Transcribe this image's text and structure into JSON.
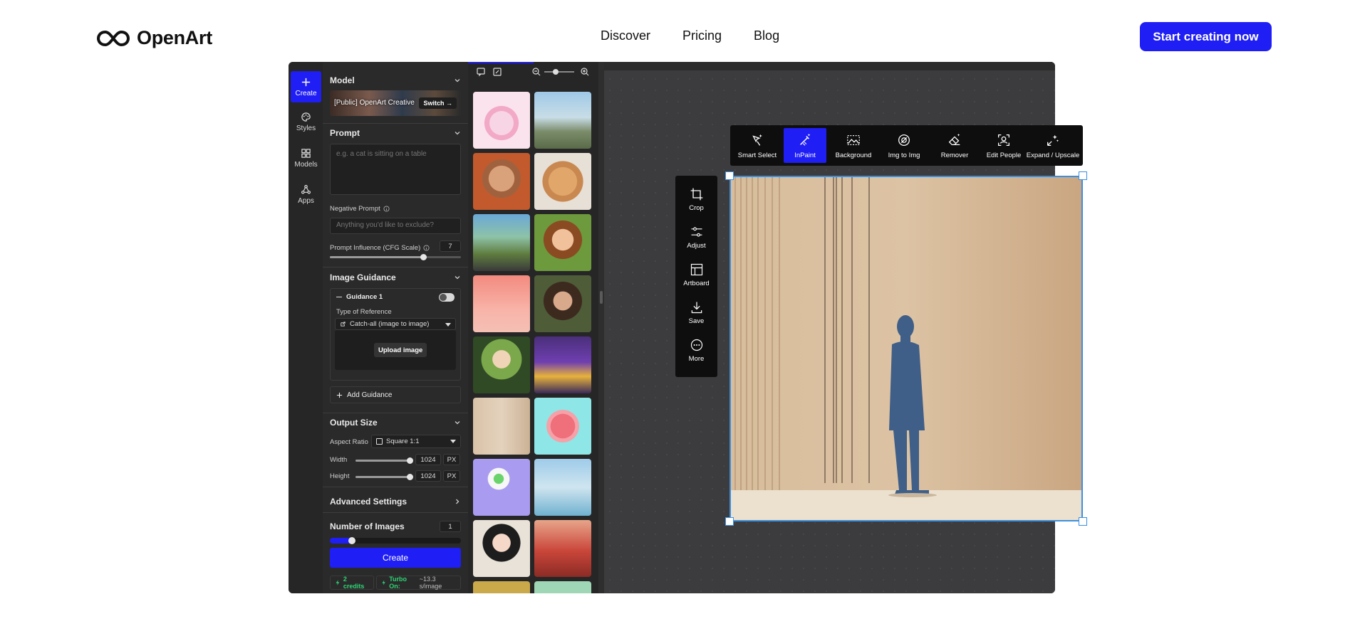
{
  "nav": {
    "brand": "OpenArt",
    "links": [
      "Discover",
      "Pricing",
      "Blog"
    ],
    "cta": "Start creating now"
  },
  "rail": [
    {
      "label": "Create",
      "icon": "plus-icon",
      "active": true
    },
    {
      "label": "Styles",
      "icon": "palette-icon",
      "active": false
    },
    {
      "label": "Models",
      "icon": "grid-icon",
      "active": false
    },
    {
      "label": "Apps",
      "icon": "apps-icon",
      "active": false
    }
  ],
  "panel": {
    "model": {
      "title": "Model",
      "name": "[Public] OpenArt Creative",
      "switch": "Switch →"
    },
    "prompt": {
      "title": "Prompt",
      "placeholder": "e.g. a cat is sitting on a table"
    },
    "negative": {
      "label": "Negative Prompt",
      "placeholder": "Anything you'd like to exclude?"
    },
    "cfg": {
      "label": "Prompt Influence (CFG Scale)",
      "value": "7",
      "fraction": 0.72
    },
    "guidance": {
      "title": "Image Guidance",
      "item": "Guidance 1",
      "type_label": "Type of Reference",
      "type_value": "Catch-all (image to image)",
      "upload": "Upload image",
      "add": "Add Guidance"
    },
    "output": {
      "title": "Output Size",
      "aspect_label": "Aspect Ratio",
      "aspect_value": "Square 1:1",
      "width_label": "Width",
      "width_value": "1024",
      "height_label": "Height",
      "height_value": "1024",
      "unit": "PX"
    },
    "advanced": "Advanced Settings",
    "num_images": {
      "label": "Number of Images",
      "value": "1",
      "fraction": 0.17
    },
    "create": "Create",
    "credits": "2 credits",
    "turbo_label": "Turbo On:",
    "turbo_value": "~13.3 s/image"
  },
  "toolbar": [
    {
      "label": "Smart Select",
      "icon": "smart-select-icon"
    },
    {
      "label": "InPaint",
      "icon": "inpaint-icon",
      "active": true
    },
    {
      "label": "Background",
      "icon": "background-icon"
    },
    {
      "label": "Img to Img",
      "icon": "img-to-img-icon"
    },
    {
      "label": "Remover",
      "icon": "eraser-icon"
    },
    {
      "label": "Edit People",
      "icon": "edit-people-icon"
    },
    {
      "label": "Expand / Upscale",
      "icon": "expand-icon"
    }
  ],
  "sidetools": [
    {
      "label": "Crop",
      "icon": "crop-icon"
    },
    {
      "label": "Adjust",
      "icon": "sliders-icon"
    },
    {
      "label": "Artboard",
      "icon": "artboard-icon"
    },
    {
      "label": "Save",
      "icon": "download-icon"
    },
    {
      "label": "More",
      "icon": "more-icon"
    }
  ],
  "colors": {
    "accent": "#1f1ef5",
    "selection": "#3d8fe0",
    "credit": "#2ed573"
  }
}
